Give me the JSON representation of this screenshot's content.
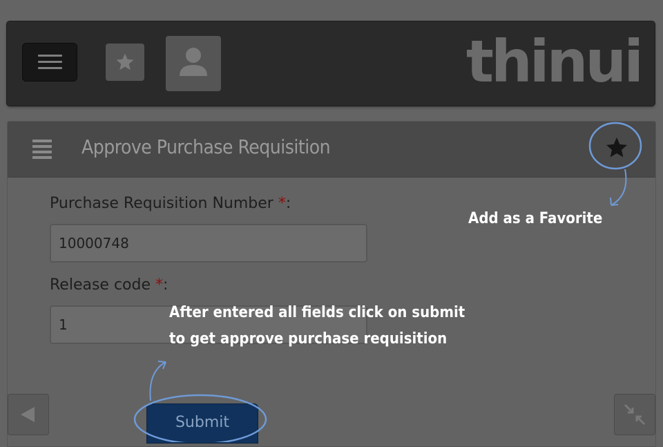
{
  "header": {
    "menu_icon": "hamburger-icon",
    "favorites_icon": "star-icon",
    "user_icon": "user-icon",
    "logo_text": "thinui"
  },
  "panel": {
    "list_icon": "list-icon",
    "title": "Approve Purchase Requisition",
    "favorite_icon": "star-icon"
  },
  "form": {
    "pr_number_label": "Purchase Requisition Number",
    "pr_number_required": "*",
    "pr_number_colon": ":",
    "pr_number_value": "10000748",
    "release_code_label": "Release code",
    "release_code_required": "*",
    "release_code_colon": ":",
    "release_code_value": "1",
    "submit_label": "Submit"
  },
  "footer": {
    "back_icon": "triangle-left-icon",
    "shrink_icon": "shrink-arrows-icon"
  },
  "hints": {
    "favorite_hint": "Add as a Favorite",
    "submit_hint_line1": "After entered all fields click on submit",
    "submit_hint_line2": "to get approve purchase requisition"
  },
  "colors": {
    "background": "#646464",
    "topbar": "#2a2a2a",
    "header": "#494949",
    "submit": "#10325c",
    "required": "#8a1010",
    "hint_outline": "#6f9ad8"
  }
}
